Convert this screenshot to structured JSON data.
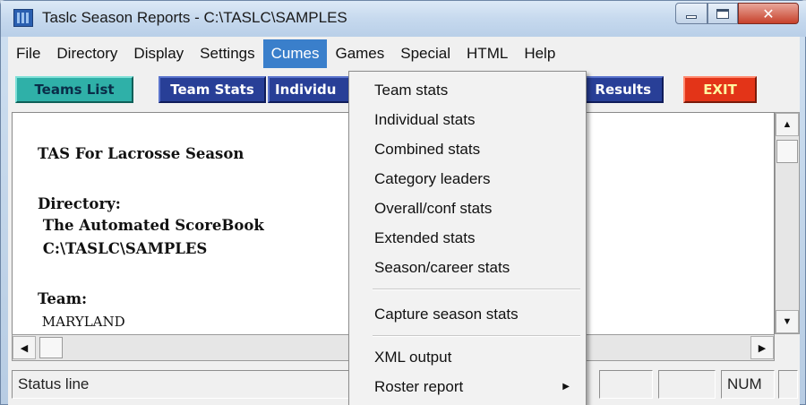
{
  "window": {
    "title": "Taslc Season Reports - C:\\TASLC\\SAMPLES"
  },
  "menubar": {
    "items": [
      "File",
      "Directory",
      "Display",
      "Settings",
      "Cumes",
      "Games",
      "Special",
      "HTML",
      "Help"
    ],
    "active": "Cumes"
  },
  "toolbar": {
    "teams_list": "Teams List",
    "team_stats": "Team Stats",
    "individual": "Individu",
    "results": "Results",
    "exit": "EXIT"
  },
  "content": {
    "lines": [
      "TAS For Lacrosse Season",
      "Directory:",
      " The Automated ScoreBook",
      " C:\\TASLC\\SAMPLES",
      "Team:",
      " MARYLAND"
    ]
  },
  "cumes_menu": {
    "items": [
      "Team stats",
      "Individual stats",
      "Combined stats",
      "Category leaders",
      "Overall/conf stats",
      "Extended stats",
      "Season/career stats",
      "Capture season stats",
      "XML output",
      "Roster report"
    ]
  },
  "statusbar": {
    "status": "Status line",
    "num": "NUM"
  },
  "colors": {
    "menu_highlight": "#3a7fcb",
    "teal_button": "#2fb0a8",
    "blue_button": "#283f97",
    "exit_button": "#e33418"
  }
}
